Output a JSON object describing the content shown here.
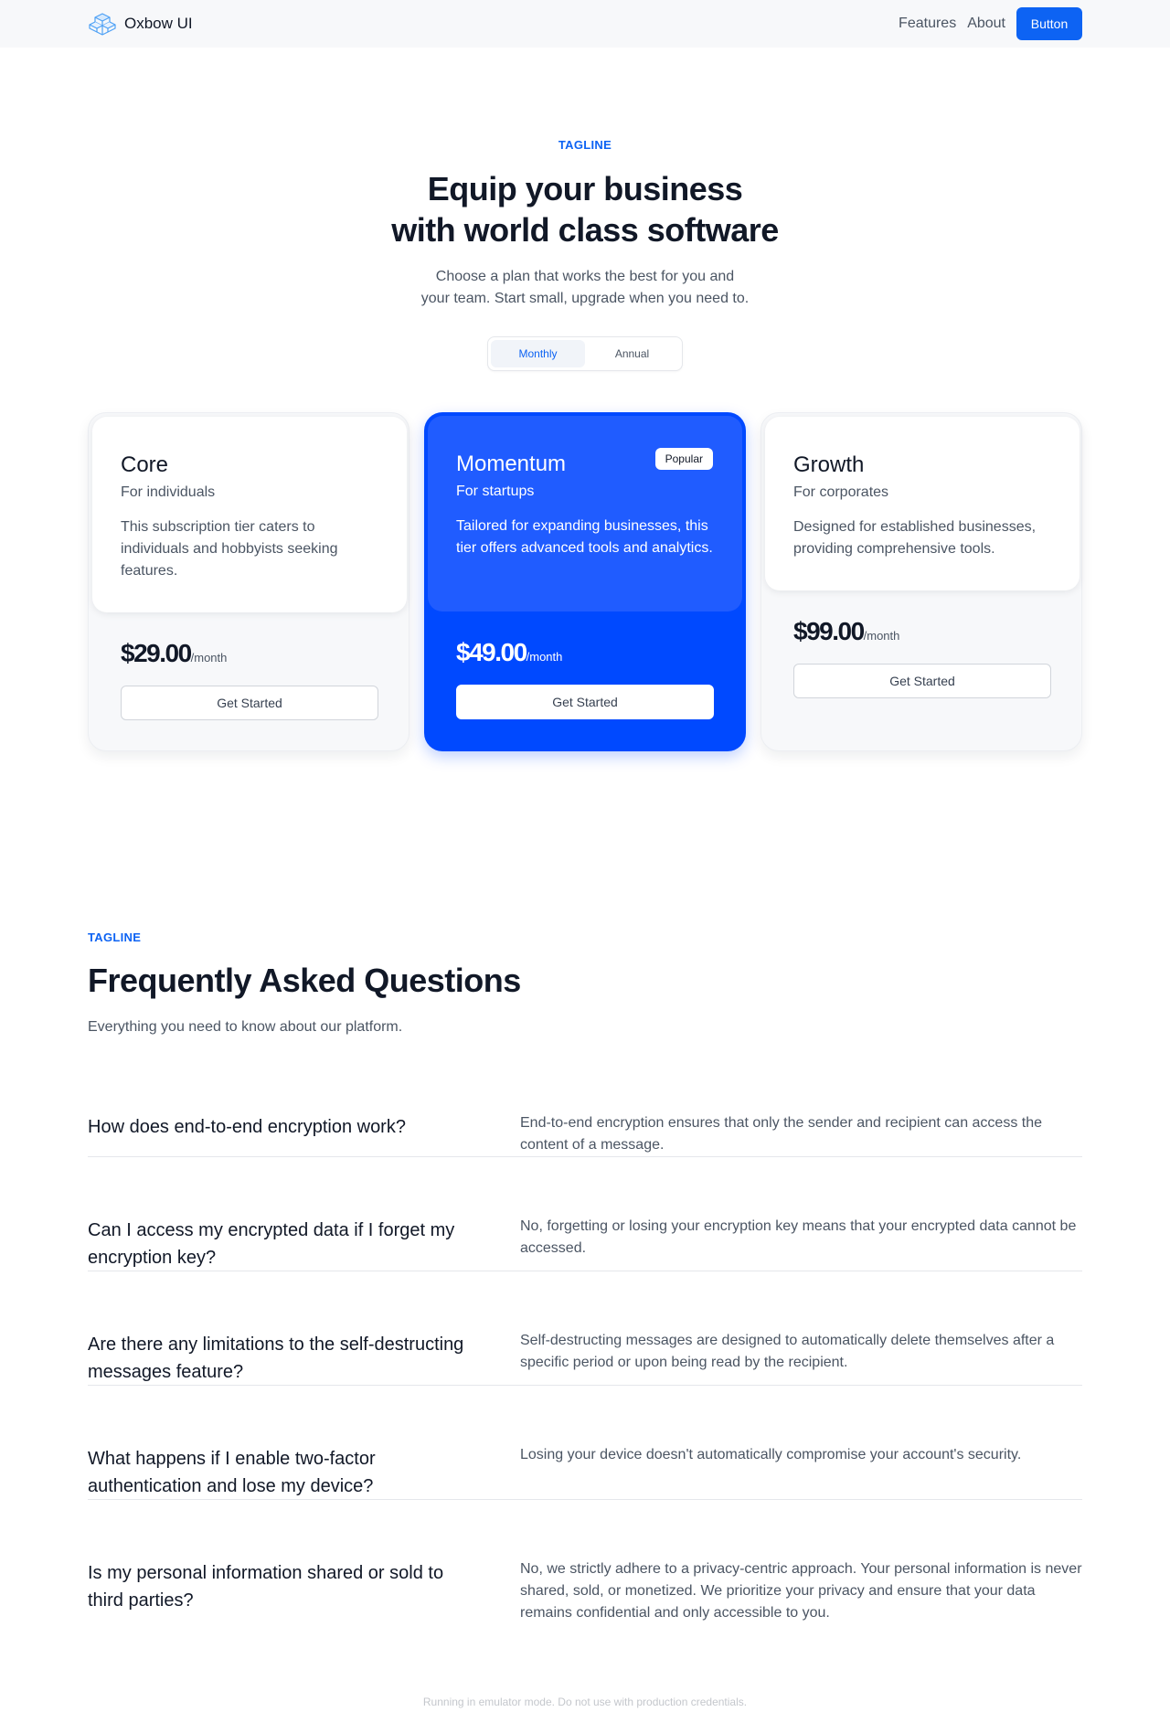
{
  "navbar": {
    "brand_name": "Oxbow UI",
    "links": [
      "Features",
      "About"
    ],
    "button_label": "Button",
    "accent_color": "#0d63f3"
  },
  "hero": {
    "tagline": "TAGLINE",
    "title_line1": "Equip your business",
    "title_line2": "with world class software",
    "subtitle_line1": "Choose a plan that works the best for you and",
    "subtitle_line2": "your team. Start small, upgrade when you need to.",
    "billing_toggle": {
      "options": [
        "Monthly",
        "Annual"
      ],
      "selected": "Monthly"
    }
  },
  "plans": [
    {
      "name": "Core",
      "audience": "For individuals",
      "description": "This subscription tier caters to individuals and hobbyists seeking features.",
      "price": "$29.00",
      "period": "/month",
      "cta": "Get Started"
    },
    {
      "name": "Momentum",
      "audience": "For startups",
      "description": "Tailored for expanding businesses, this tier offers advanced tools and analytics.",
      "price": "$49.00",
      "period": "/month",
      "cta": "Get Started",
      "badge": "Popular",
      "highlight_color": "#0049ff"
    },
    {
      "name": "Growth",
      "audience": "For corporates",
      "description": "Designed for established businesses, providing comprehensive tools.",
      "price": "$99.00",
      "period": "/month",
      "cta": "Get Started"
    }
  ],
  "faq": {
    "tagline": "TAGLINE",
    "title": "Frequently Asked Questions",
    "subtitle": "Everything you need to know about our platform.",
    "items": [
      {
        "question": "How does end-to-end encryption work?",
        "answer": "End-to-end encryption ensures that only the sender and recipient can access the content of a message."
      },
      {
        "question": "Can I access my encrypted data if I forget my encryption key?",
        "answer": "No, forgetting or losing your encryption key means that your encrypted data cannot be accessed."
      },
      {
        "question": "Are there any limitations to the self-destructing messages feature?",
        "answer": "Self-destructing messages are designed to automatically delete themselves after a specific period or upon being read by the recipient."
      },
      {
        "question": "What happens if I enable two-factor authentication and lose my device?",
        "answer": "Losing your device doesn't automatically compromise your account's security."
      },
      {
        "question": "Is my personal information shared or sold to third parties?",
        "answer": "No, we strictly adhere to a privacy-centric approach. Your personal information is never shared, sold, or monetized. We prioritize your privacy and ensure that your data remains confidential and only accessible to you."
      }
    ]
  },
  "footer": {
    "note": "Running in emulator mode. Do not use with production credentials."
  }
}
